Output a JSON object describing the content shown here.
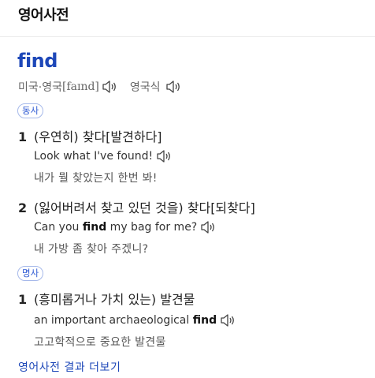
{
  "header": {
    "title": "영어사전"
  },
  "entry": {
    "word": "find",
    "pron_us_label": "미국·영국",
    "pron_ipa": "[faɪnd]",
    "pron_uk_label": "영국식"
  },
  "groups": [
    {
      "pos": "동사",
      "senses": [
        {
          "num": "1",
          "def": "(우연히) 찾다[발견하다]",
          "ex_pre": "Look what I've found!",
          "ex_bold": "",
          "ex_post": "",
          "ex_ko": "내가 뭘 찾았는지 한번 봐!"
        },
        {
          "num": "2",
          "def": "(잃어버려서 찾고 있던 것을) 찾다[되찾다]",
          "ex_pre": "Can you ",
          "ex_bold": "find",
          "ex_post": " my bag for me?",
          "ex_ko": "내 가방 좀 찾아 주겠니?"
        }
      ]
    },
    {
      "pos": "명사",
      "senses": [
        {
          "num": "1",
          "def": "(흥미롭거나 가치 있는) 발견물",
          "ex_pre": "an important archaeological ",
          "ex_bold": "find",
          "ex_post": "",
          "ex_ko": "고고학적으로 중요한 발견물"
        }
      ]
    }
  ],
  "footer": {
    "more_link": "영어사전 결과 더보기"
  },
  "icons": {
    "speaker": "speaker-icon"
  },
  "colors": {
    "accent": "#1d47b8",
    "pos_badge": "#2f5bd3"
  }
}
